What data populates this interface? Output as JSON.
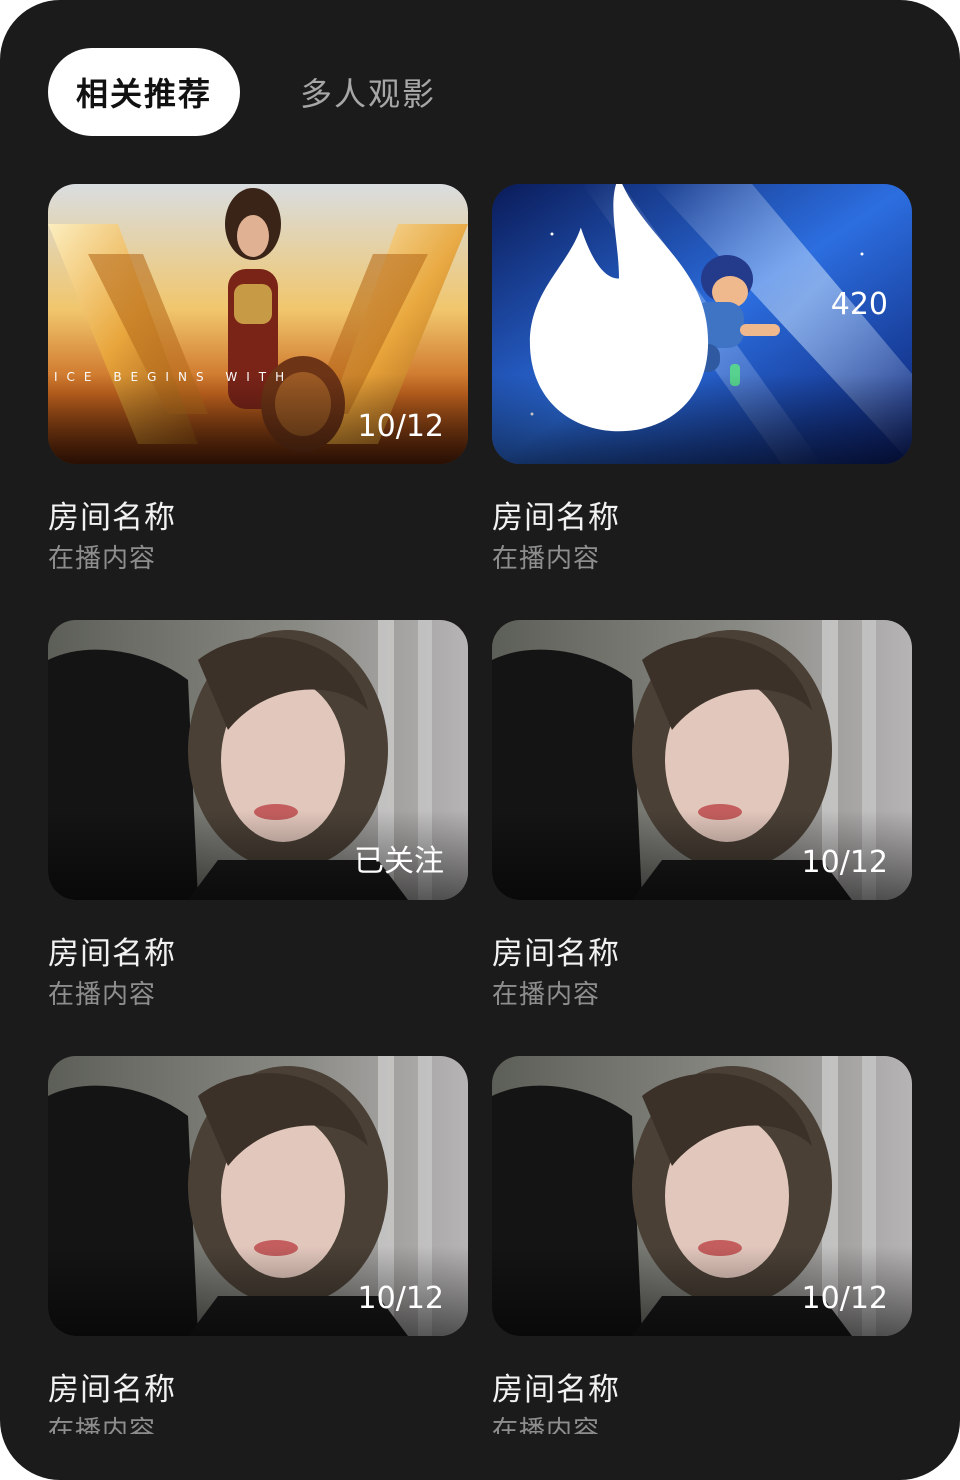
{
  "tabs": [
    {
      "label": "相关推荐",
      "active": true
    },
    {
      "label": "多人观影",
      "active": false
    }
  ],
  "cards": [
    {
      "title": "房间名称",
      "subtitle": "在播内容",
      "badge": "10/12",
      "thumbnail": "wonder-woman-poster"
    },
    {
      "title": "房间名称",
      "subtitle": "在播内容",
      "badge": "420",
      "badge_icon": "fire-icon",
      "thumbnail": "animated-boy-space"
    },
    {
      "title": "房间名称",
      "subtitle": "在播内容",
      "badge": "已关注",
      "thumbnail": "portrait-woman"
    },
    {
      "title": "房间名称",
      "subtitle": "在播内容",
      "badge": "10/12",
      "thumbnail": "portrait-woman"
    },
    {
      "title": "房间名称",
      "subtitle": "在播内容",
      "badge": "10/12",
      "thumbnail": "portrait-woman"
    },
    {
      "title": "房间名称",
      "subtitle": "在播内容",
      "badge": "10/12",
      "thumbnail": "portrait-woman"
    }
  ],
  "colors": {
    "panel_bg": "#1b1b1b",
    "tab_active_bg": "#ffffff",
    "tab_inactive_text": "#a7a7a7",
    "title_text": "#f2f2f2",
    "subtitle_text": "#8e8e8e"
  }
}
